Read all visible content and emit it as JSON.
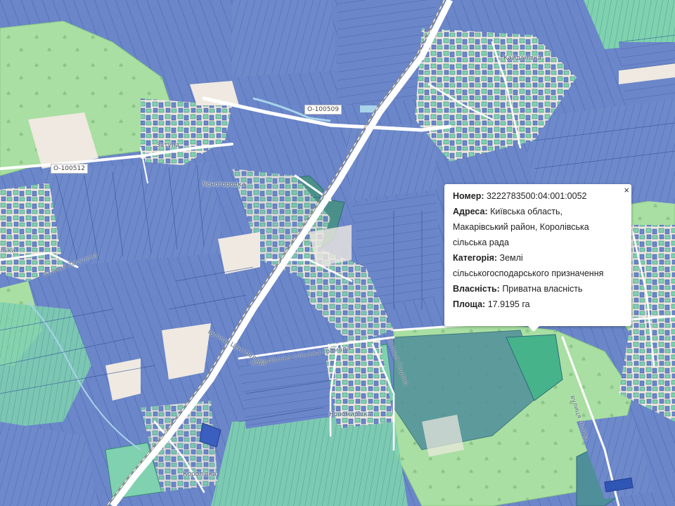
{
  "map": {
    "road_labels": [
      "O-100509",
      "O-100512"
    ],
    "place_labels": [
      "Кайданівка",
      "Затула",
      "Ясногородка",
      "Королівська сільська громада",
      "Новомирівка",
      "Королівка",
      "лька"
    ],
    "street_labels": [
      "вулиця Затульна",
      "вулиця Центральна",
      "вулиця Садова",
      "вулиця Лісова"
    ]
  },
  "popup": {
    "close_glyph": "×",
    "number_label": "Номер:",
    "number_value": "3222783500:04:001:0052",
    "address_label": "Адреса:",
    "address_line1": "Київська область,",
    "address_line2": "Макарівський район, Королівська",
    "address_line3": "сільська рада",
    "category_label": "Категорія:",
    "category_line1": "Землі",
    "category_line2": "сільськогосподарського призначення",
    "ownership_label": "Власність:",
    "ownership_value": "Приватна власність",
    "area_label": "Площа:",
    "area_value": "17.9195 га"
  },
  "colors": {
    "background": "#efe9e1",
    "parcel_blue": "#6b86c9",
    "parcel_blue_dark": "#4f6fb8",
    "parcel_green": "#7fd1b0",
    "forest_green": "#a9dfa2",
    "road_white": "#ffffff",
    "rail_gray": "#8a8a8a",
    "water": "#a9d3ea"
  }
}
